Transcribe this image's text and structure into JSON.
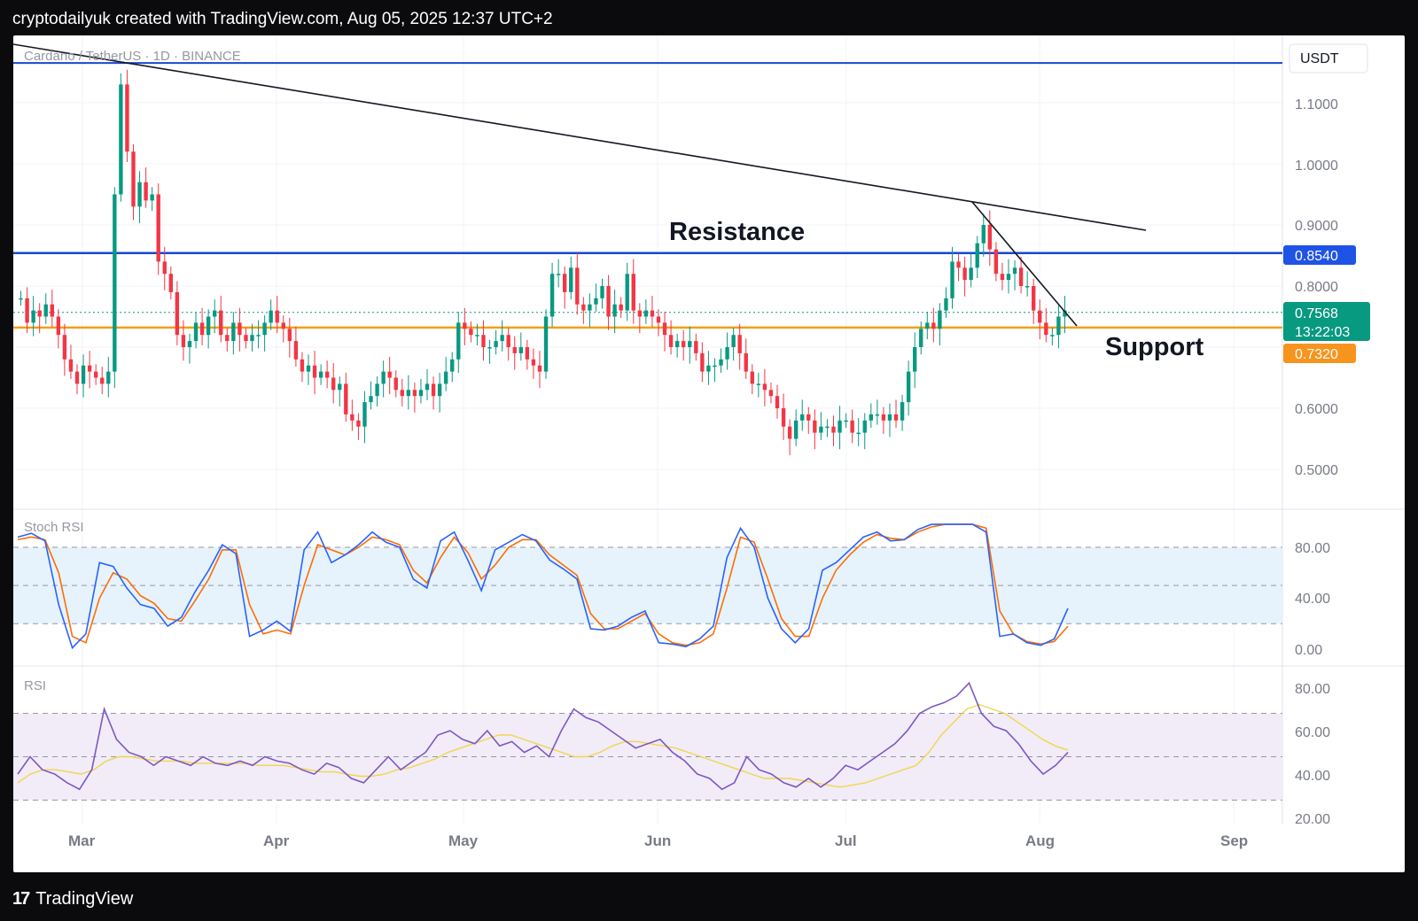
{
  "header": {
    "text": "cryptodailyuk created with TradingView.com, Aug 05, 2025 12:37 UTC+2"
  },
  "footer": {
    "brand": "TradingView"
  },
  "chart_data": {
    "type": "candlestick",
    "title": "Cardano / TetherUS · 1D · BINANCE",
    "currency": "USDT",
    "x_labels": [
      "Mar",
      "Apr",
      "May",
      "Jun",
      "Jul",
      "Aug",
      "Sep"
    ],
    "price_ticks": [
      "1.1000",
      "1.0000",
      "0.9000",
      "0.8000",
      "0.6000",
      "0.5000"
    ],
    "ylim": [
      0.45,
      1.2
    ],
    "price": {
      "current": "0.7568",
      "countdown": "13:22:03",
      "resistance": "0.8540",
      "support": "0.7320",
      "top_level": 1.165
    },
    "annotations": {
      "resistance": "Resistance",
      "support": "Support"
    },
    "series": [
      {
        "name": "Close (approx. daily)",
        "values": [
          0.78,
          0.74,
          0.76,
          0.75,
          0.77,
          0.75,
          0.72,
          0.68,
          0.66,
          0.64,
          0.67,
          0.66,
          0.65,
          0.64,
          0.66,
          0.95,
          1.13,
          1.02,
          0.93,
          0.97,
          0.94,
          0.95,
          0.84,
          0.82,
          0.79,
          0.72,
          0.7,
          0.71,
          0.74,
          0.72,
          0.75,
          0.76,
          0.72,
          0.71,
          0.74,
          0.72,
          0.71,
          0.72,
          0.72,
          0.74,
          0.76,
          0.74,
          0.73,
          0.71,
          0.68,
          0.66,
          0.67,
          0.65,
          0.66,
          0.65,
          0.63,
          0.64,
          0.59,
          0.58,
          0.57,
          0.61,
          0.62,
          0.64,
          0.66,
          0.65,
          0.63,
          0.62,
          0.63,
          0.62,
          0.63,
          0.64,
          0.62,
          0.64,
          0.66,
          0.68,
          0.74,
          0.73,
          0.72,
          0.72,
          0.7,
          0.7,
          0.71,
          0.72,
          0.7,
          0.69,
          0.7,
          0.68,
          0.67,
          0.66,
          0.75,
          0.82,
          0.82,
          0.79,
          0.83,
          0.77,
          0.76,
          0.77,
          0.78,
          0.8,
          0.75,
          0.77,
          0.76,
          0.82,
          0.76,
          0.75,
          0.76,
          0.75,
          0.74,
          0.72,
          0.7,
          0.71,
          0.7,
          0.71,
          0.69,
          0.66,
          0.67,
          0.67,
          0.68,
          0.7,
          0.72,
          0.69,
          0.66,
          0.64,
          0.64,
          0.63,
          0.62,
          0.6,
          0.57,
          0.55,
          0.58,
          0.59,
          0.58,
          0.56,
          0.57,
          0.57,
          0.56,
          0.58,
          0.58,
          0.56,
          0.56,
          0.58,
          0.59,
          0.59,
          0.58,
          0.59,
          0.58,
          0.61,
          0.66,
          0.7,
          0.73,
          0.74,
          0.73,
          0.76,
          0.78,
          0.84,
          0.83,
          0.81,
          0.83,
          0.87,
          0.9,
          0.86,
          0.82,
          0.81,
          0.82,
          0.83,
          0.8,
          0.8,
          0.76,
          0.74,
          0.72,
          0.72,
          0.75,
          0.76
        ]
      },
      {
        "name": "Stoch RSI K",
        "values": [
          88,
          91,
          85,
          35,
          1,
          12,
          68,
          65,
          48,
          35,
          32,
          18,
          25,
          45,
          62,
          82,
          75,
          10,
          15,
          22,
          14,
          78,
          92,
          68,
          74,
          82,
          92,
          84,
          80,
          55,
          48,
          85,
          92,
          70,
          46,
          78,
          84,
          90,
          85,
          70,
          63,
          55,
          16,
          15,
          18,
          25,
          30,
          5,
          4,
          2,
          8,
          18,
          72,
          95,
          80,
          40,
          16,
          5,
          16,
          62,
          68,
          78,
          88,
          92,
          85,
          86,
          94,
          98,
          98,
          98,
          98,
          92,
          10,
          12,
          5,
          3,
          8,
          32
        ]
      },
      {
        "name": "Stoch RSI D",
        "values": [
          86,
          88,
          86,
          60,
          10,
          5,
          40,
          60,
          55,
          42,
          36,
          24,
          22,
          38,
          55,
          78,
          78,
          35,
          12,
          15,
          12,
          50,
          82,
          78,
          74,
          80,
          88,
          86,
          82,
          62,
          52,
          72,
          88,
          76,
          55,
          66,
          80,
          86,
          86,
          74,
          66,
          58,
          28,
          16,
          16,
          22,
          28,
          12,
          5,
          3,
          5,
          12,
          48,
          88,
          84,
          55,
          24,
          10,
          10,
          40,
          62,
          74,
          84,
          90,
          87,
          86,
          92,
          96,
          98,
          98,
          98,
          95,
          30,
          12,
          6,
          4,
          6,
          18
        ]
      },
      {
        "name": "RSI",
        "values": [
          42,
          50,
          44,
          42,
          38,
          35,
          44,
          72,
          58,
          52,
          50,
          46,
          50,
          48,
          46,
          50,
          47,
          46,
          48,
          46,
          50,
          48,
          47,
          44,
          42,
          47,
          45,
          40,
          38,
          44,
          50,
          44,
          48,
          52,
          60,
          62,
          58,
          56,
          62,
          55,
          57,
          52,
          55,
          50,
          62,
          72,
          68,
          66,
          62,
          58,
          54,
          56,
          58,
          52,
          48,
          42,
          40,
          35,
          38,
          50,
          44,
          42,
          38,
          36,
          40,
          36,
          40,
          46,
          44,
          48,
          52,
          56,
          62,
          70,
          73,
          75,
          78,
          84,
          70,
          64,
          62,
          56,
          48,
          42,
          46,
          52
        ]
      },
      {
        "name": "RSI MA",
        "values": [
          38,
          42,
          44,
          44,
          43,
          42,
          44,
          48,
          50,
          50,
          49,
          48,
          48,
          48,
          47,
          47,
          47,
          47,
          47,
          46,
          46,
          46,
          45,
          44,
          43,
          43,
          42,
          41,
          41,
          42,
          44,
          45,
          47,
          49,
          52,
          54,
          56,
          58,
          60,
          60,
          58,
          56,
          54,
          52,
          50,
          50,
          52,
          55,
          57,
          57,
          56,
          55,
          54,
          52,
          50,
          48,
          46,
          44,
          42,
          40,
          40,
          40,
          39,
          38,
          37,
          36,
          37,
          38,
          40,
          42,
          44,
          46,
          52,
          60,
          66,
          72,
          74,
          72,
          70,
          66,
          62,
          58,
          55,
          53
        ]
      }
    ],
    "stoch_label": "Stoch RSI",
    "stoch_ticks": [
      "80.00",
      "40.00",
      "0.00"
    ],
    "rsi_label": "RSI",
    "rsi_ticks": [
      "80.00",
      "60.00",
      "40.00",
      "20.00"
    ]
  },
  "colors": {
    "up": "#089981",
    "down": "#f23645",
    "resistance_line": "#1848cc",
    "support_line": "#f0a017",
    "current_price_tag": "#089981",
    "support_tag": "#f7941d",
    "resistance_tag": "#1e53e5",
    "stoch_k": "#2962ff",
    "stoch_d": "#ff6d00",
    "rsi": "#7e57c2",
    "rsi_ma": "#f2d54a"
  }
}
